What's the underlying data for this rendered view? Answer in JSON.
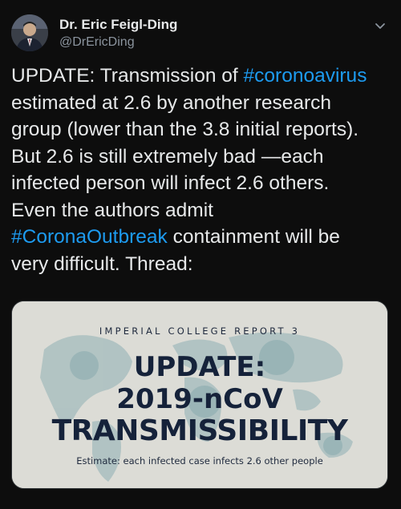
{
  "author": {
    "display_name": "Dr. Eric Feigl-Ding",
    "handle": "@DrEricDing"
  },
  "icons": {
    "avatar": "profile-photo",
    "menu": "chevron-down-icon"
  },
  "tweet": {
    "lines": [
      {
        "pre": "UPDATE: Transmission of ",
        "tag": "#coronoavirus",
        "post": ""
      },
      {
        "pre": "estimated at 2.6 by another research",
        "tag": "",
        "post": ""
      },
      {
        "pre": "group (lower than the 3.8 initial reports).",
        "tag": "",
        "post": ""
      },
      {
        "pre": "But 2.6 is still extremely bad —each",
        "tag": "",
        "post": ""
      },
      {
        "pre": "infected person will infect 2.6 others.",
        "tag": "",
        "post": ""
      },
      {
        "pre": "Even the authors admit",
        "tag": "",
        "post": ""
      },
      {
        "pre": "",
        "tag": "#CoronaOutbreak",
        "post": " containment will be"
      },
      {
        "pre": "very difficult. Thread:",
        "tag": "",
        "post": ""
      }
    ]
  },
  "media": {
    "report_label": "IMPERIAL COLLEGE REPORT 3",
    "headline_1": "UPDATE:",
    "headline_2": "2019-nCoV",
    "headline_3": "TRANSMISSIBILITY",
    "caption": "Estimate: each infected case infects 2.6 other people"
  },
  "colors": {
    "background": "#0d0d0d",
    "text": "#e7e9ea",
    "muted": "#8b949e",
    "link": "#1d9bf0",
    "card_bg": "#dcdcd6",
    "card_text": "#15223a"
  }
}
